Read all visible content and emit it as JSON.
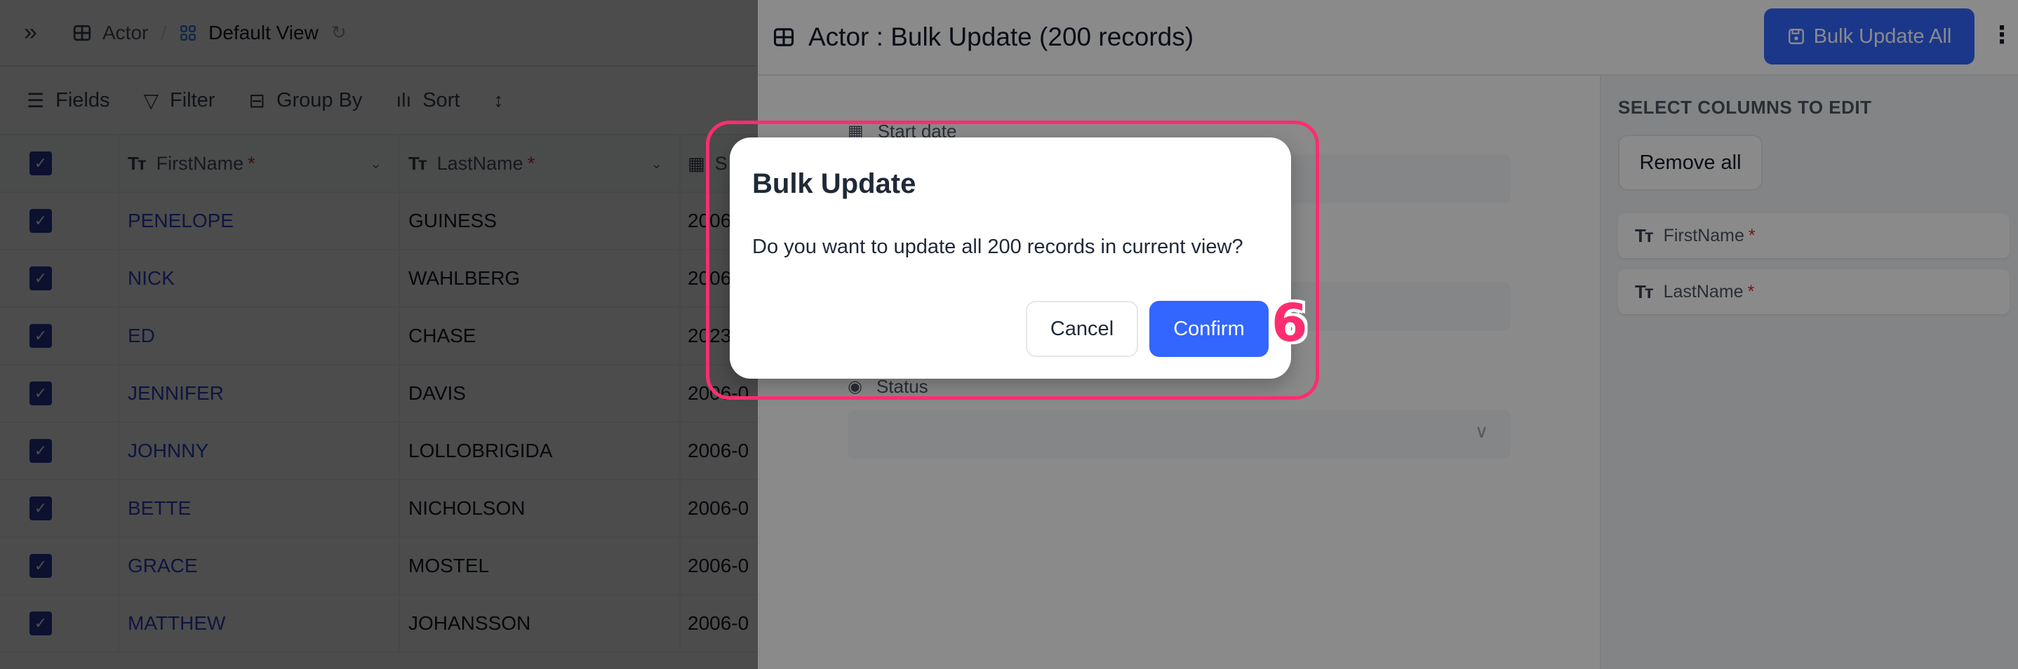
{
  "grid": {
    "breadcrumb": {
      "table_name": "Actor",
      "separator": "/",
      "view_name": "Default View"
    },
    "icons": {
      "expand": "double-chevron-right-icon",
      "table": "table-grid-icon",
      "view": "grid-view-icon",
      "reload": "reload-icon"
    },
    "toolbar": {
      "fields_label": "Fields",
      "filter_label": "Filter",
      "group_by_label": "Group By",
      "sort_label": "Sort"
    },
    "columns": [
      {
        "label": "FirstName",
        "required_marker": "*",
        "type_icon": "Tт"
      },
      {
        "label": "LastName",
        "required_marker": "*",
        "type_icon": "Tт"
      },
      {
        "label": "S",
        "type_icon": "calendar-icon"
      }
    ],
    "rows": [
      {
        "first": "PENELOPE",
        "last": "GUINESS",
        "date": "2006",
        "selected": true
      },
      {
        "first": "NICK",
        "last": "WAHLBERG",
        "date": "2006",
        "selected": true
      },
      {
        "first": "ED",
        "last": "CHASE",
        "date": "2023",
        "selected": true
      },
      {
        "first": "JENNIFER",
        "last": "DAVIS",
        "date": "2006-0",
        "selected": true
      },
      {
        "first": "JOHNNY",
        "last": "LOLLOBRIGIDA",
        "date": "2006-0",
        "selected": true
      },
      {
        "first": "BETTE",
        "last": "NICHOLSON",
        "date": "2006-0",
        "selected": true
      },
      {
        "first": "GRACE",
        "last": "MOSTEL",
        "date": "2006-0",
        "selected": true
      },
      {
        "first": "MATTHEW",
        "last": "JOHANSSON",
        "date": "2006-0",
        "selected": true
      }
    ]
  },
  "panel": {
    "title": "Actor : Bulk Update (200 records)",
    "bulk_update_all_label": "Bulk Update All",
    "more_label": "⋮",
    "form": {
      "start_date_label": "Start date",
      "status_label": "Status"
    },
    "sidebar": {
      "title": "SELECT COLUMNS TO EDIT",
      "remove_all_label": "Remove all",
      "selected_columns": [
        {
          "label": "FirstName",
          "required_marker": "*"
        },
        {
          "label": "LastName",
          "required_marker": "*"
        }
      ]
    }
  },
  "dialog": {
    "title": "Bulk Update",
    "message": "Do you want to update all 200 records in current view?",
    "cancel_label": "Cancel",
    "confirm_label": "Confirm"
  },
  "annotation": {
    "step_number": "6",
    "color": "#ff2d6f"
  },
  "colors": {
    "primary": "#3366ff",
    "checkbox": "#2b3a9e",
    "link_text": "#2f46d6",
    "required": "#dc2626"
  }
}
